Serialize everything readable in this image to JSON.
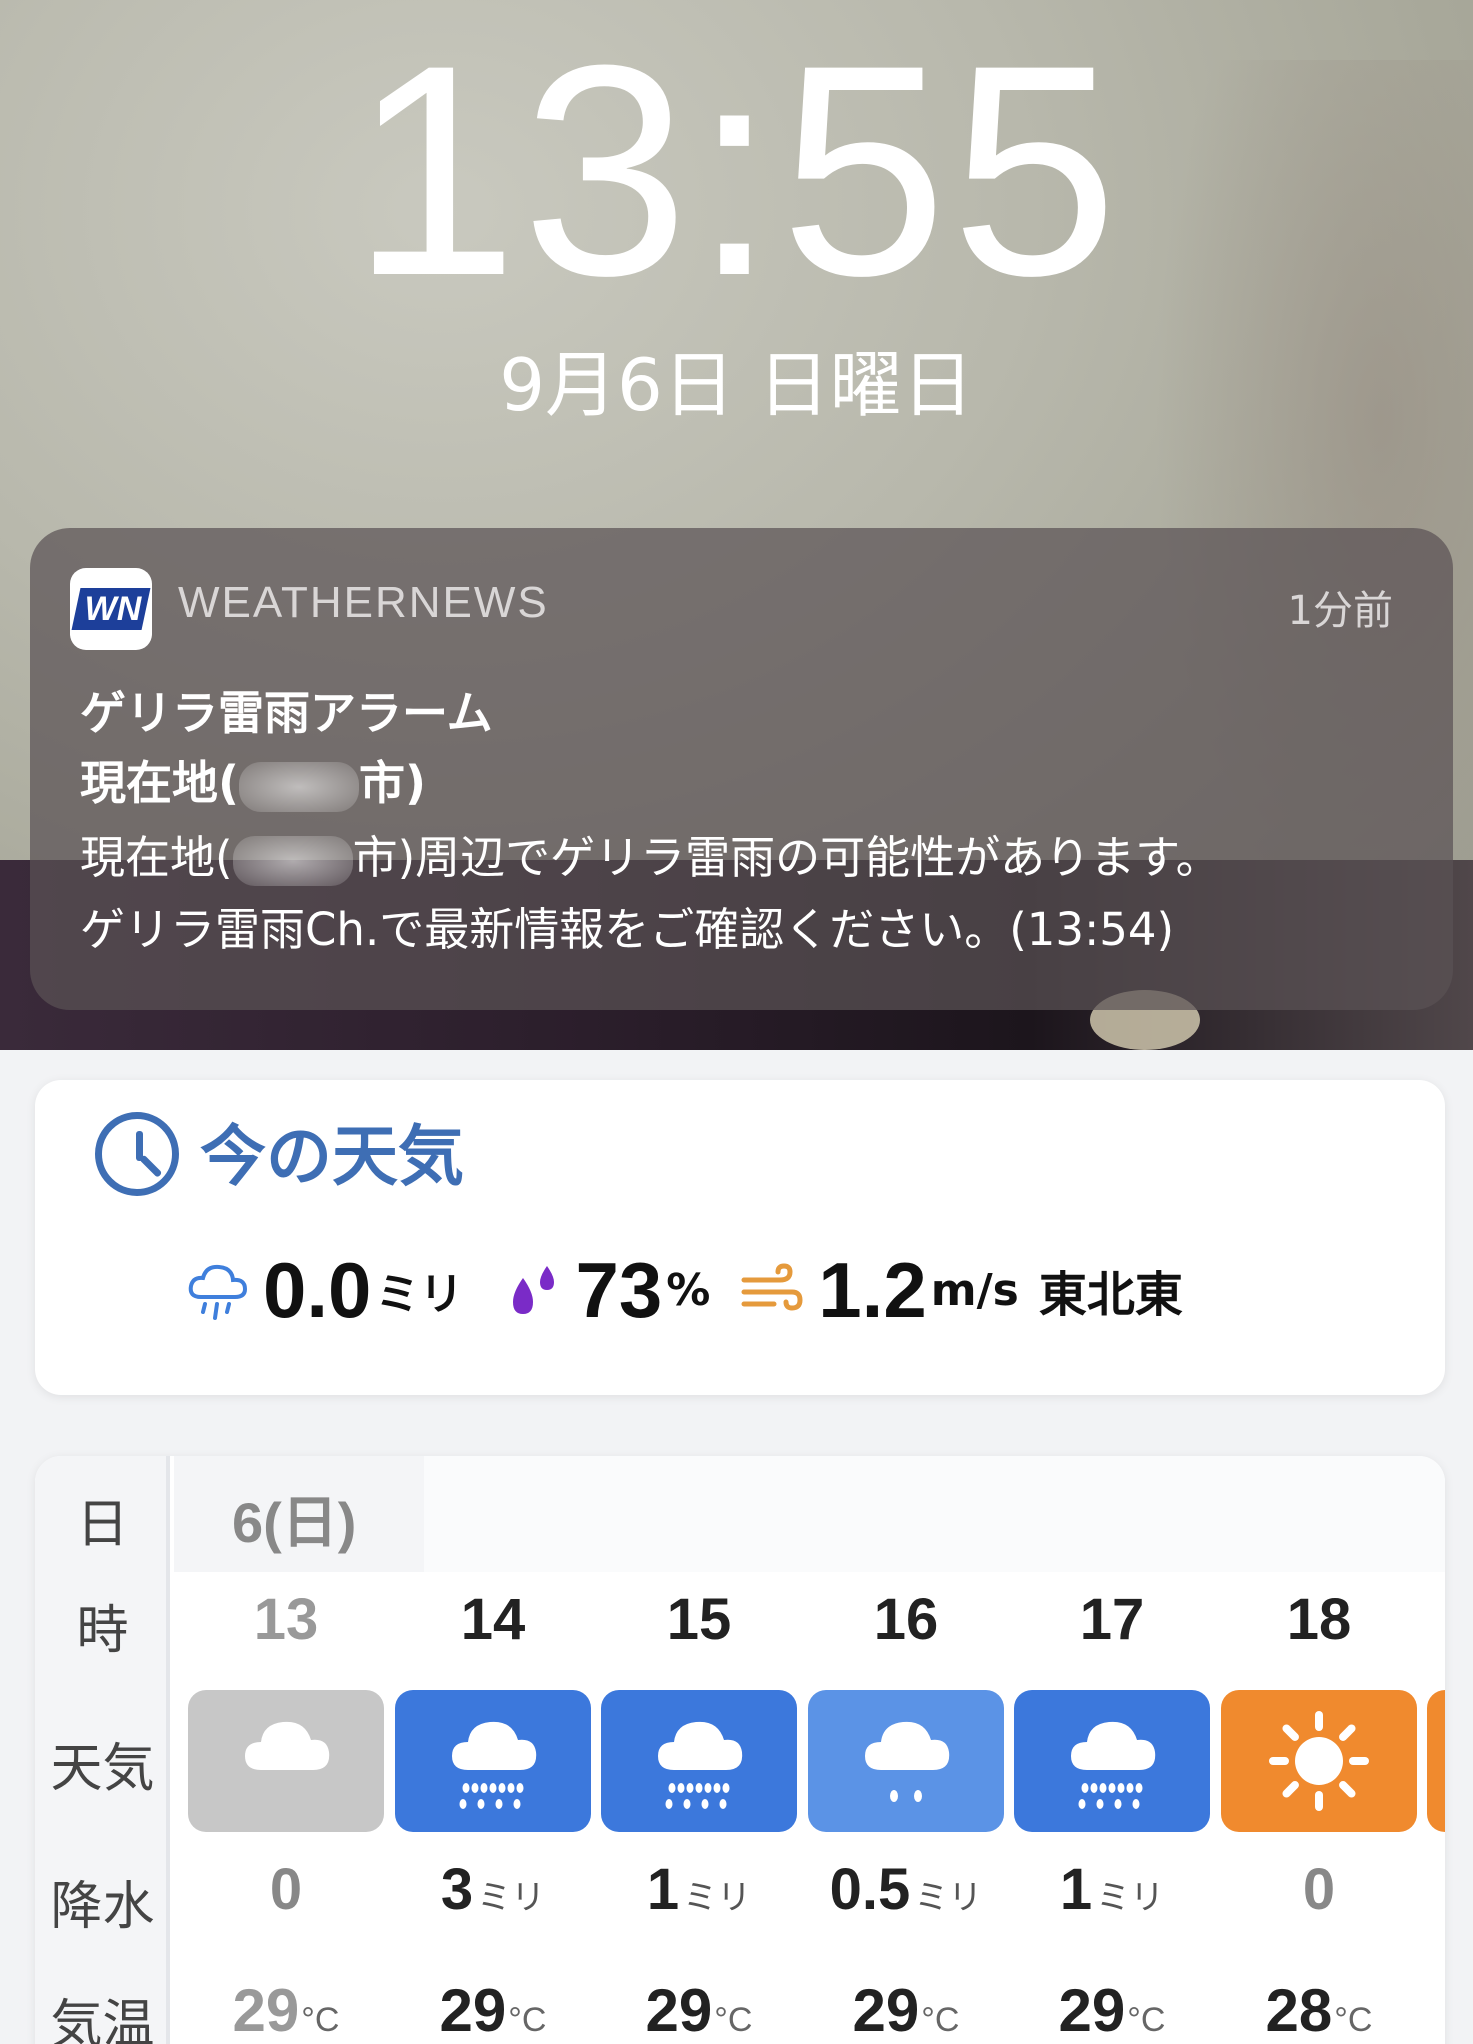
{
  "lockscreen": {
    "time": "13:55",
    "date": "9月6日 日曜日"
  },
  "notification": {
    "app_icon_text": "WN",
    "app_name": "WEATHERNEWS",
    "time_ago": "1分前",
    "title": "ゲリラ雷雨アラーム",
    "subtitle_prefix": "現在地(",
    "subtitle_suffix": "市)",
    "body_line1_prefix": "現在地(",
    "body_line1_suffix": "市)周辺でゲリラ雷雨の可能性があります。",
    "body_line2": "ゲリラ雷雨Ch.で最新情報をご確認ください。(13:54)"
  },
  "current": {
    "title": "今の天気",
    "rain_value": "0.0",
    "rain_unit": "ミリ",
    "humidity_value": "73",
    "humidity_unit": "%",
    "wind_value": "1.2",
    "wind_unit": "m/s",
    "wind_direction": "東北東",
    "colors": {
      "accent": "#3e6eb4",
      "rain_icon": "#3f7fdc",
      "humidity_icon": "#7a2bc7",
      "wind_icon": "#e59a3c"
    }
  },
  "forecast": {
    "row_labels": {
      "day": "日",
      "hour": "時",
      "weather": "天気",
      "rain": "降水",
      "temp": "気温"
    },
    "day": "6(日)",
    "hours": [
      {
        "hour": "13",
        "weather": "cloudy",
        "rain": "0",
        "rain_unit": "",
        "temp": "29",
        "temp_unit": "°C",
        "past": true
      },
      {
        "hour": "14",
        "weather": "rain",
        "rain": "3",
        "rain_unit": "ミリ",
        "temp": "29",
        "temp_unit": "°C",
        "past": false
      },
      {
        "hour": "15",
        "weather": "rain",
        "rain": "1",
        "rain_unit": "ミリ",
        "temp": "29",
        "temp_unit": "°C",
        "past": false
      },
      {
        "hour": "16",
        "weather": "light-rain",
        "rain": "0.5",
        "rain_unit": "ミリ",
        "temp": "29",
        "temp_unit": "°C",
        "past": false
      },
      {
        "hour": "17",
        "weather": "rain",
        "rain": "1",
        "rain_unit": "ミリ",
        "temp": "29",
        "temp_unit": "°C",
        "past": false
      },
      {
        "hour": "18",
        "weather": "sunny",
        "rain": "0",
        "rain_unit": "",
        "temp": "28",
        "temp_unit": "°C",
        "past": false
      }
    ],
    "colors": {
      "cloudy": "#c7c7c7",
      "rain": "#3c78dc",
      "light-rain": "#5b93e6",
      "sunny": "#f08a2e"
    }
  }
}
